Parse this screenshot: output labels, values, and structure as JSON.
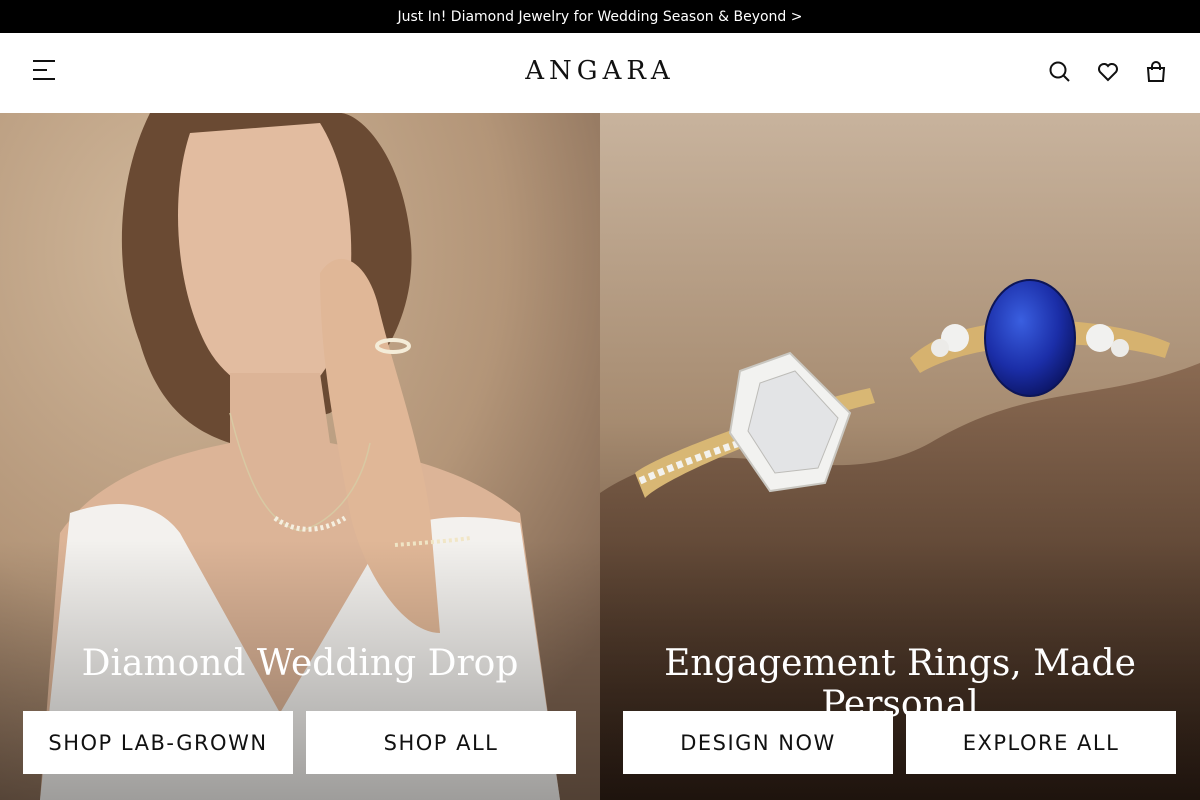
{
  "announcement": {
    "text": "Just In! Diamond Jewelry for Wedding Season & Beyond >"
  },
  "header": {
    "logo": "ANGARA",
    "icons": {
      "menu": "menu-icon",
      "search": "search-icon",
      "wishlist": "heart-icon",
      "cart": "shopping-bag-icon"
    }
  },
  "hero": {
    "left": {
      "title": "Diamond Wedding Drop",
      "buttons": [
        "SHOP LAB-GROWN",
        "SHOP ALL"
      ]
    },
    "right": {
      "title": "Engagement Rings, Made Personal",
      "buttons": [
        "DESIGN NOW",
        "EXPLORE ALL"
      ]
    }
  },
  "colors": {
    "topbar": "#000000",
    "button_bg": "#ffffff",
    "text_dark": "#111111",
    "title_text": "#ffffff"
  }
}
